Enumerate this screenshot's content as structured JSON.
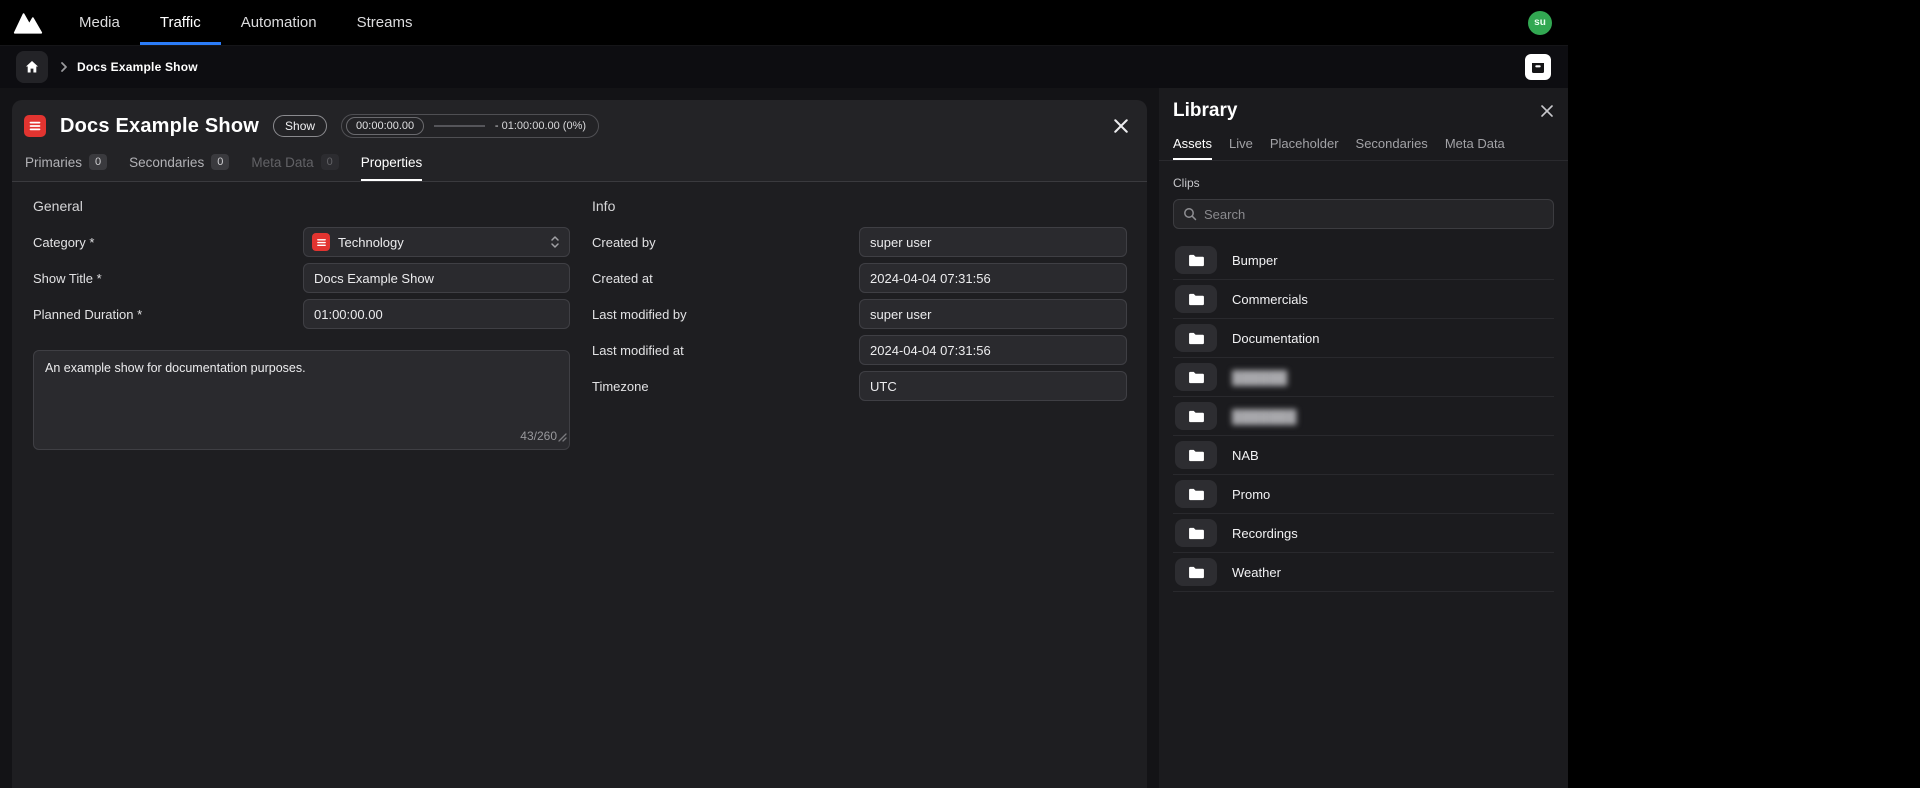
{
  "colors": {
    "accent_blue": "#2b7cf8",
    "category_red": "#e23430",
    "avatar_green": "#32a852"
  },
  "topnav": {
    "items": [
      {
        "label": "Media"
      },
      {
        "label": "Traffic",
        "active": true
      },
      {
        "label": "Automation"
      },
      {
        "label": "Streams"
      }
    ],
    "avatar_initials": "su"
  },
  "breadcrumb": {
    "current": "Docs Example Show"
  },
  "panel": {
    "title": "Docs Example Show",
    "type_badge": "Show",
    "progress": {
      "elapsed": "00:00:00.00",
      "remaining": "- 01:00:00.00 (0%)",
      "percent": 0
    },
    "tabs": [
      {
        "label": "Primaries",
        "count": "0"
      },
      {
        "label": "Secondaries",
        "count": "0"
      },
      {
        "label": "Meta Data",
        "count": "0",
        "disabled": true
      },
      {
        "label": "Properties",
        "active": true
      }
    ],
    "general": {
      "heading": "General",
      "fields": [
        {
          "label": "Category *",
          "value": "Technology",
          "type": "select"
        },
        {
          "label": "Show Title *",
          "value": "Docs Example Show",
          "type": "text"
        },
        {
          "label": "Planned Duration *",
          "value": "01:00:00.00",
          "type": "text"
        }
      ],
      "description": "An example show for documentation purposes.",
      "char_count": "43/260"
    },
    "info": {
      "heading": "Info",
      "fields": [
        {
          "label": "Created by",
          "value": "super user"
        },
        {
          "label": "Created at",
          "value": "2024-04-04 07:31:56"
        },
        {
          "label": "Last modified by",
          "value": "super user"
        },
        {
          "label": "Last modified at",
          "value": "2024-04-04 07:31:56"
        },
        {
          "label": "Timezone",
          "value": "UTC"
        }
      ]
    }
  },
  "library": {
    "title": "Library",
    "tabs": [
      {
        "label": "Assets",
        "active": true
      },
      {
        "label": "Live"
      },
      {
        "label": "Placeholder"
      },
      {
        "label": "Secondaries"
      },
      {
        "label": "Meta Data"
      }
    ],
    "section_label": "Clips",
    "search_placeholder": "Search",
    "folders": [
      {
        "label": "Bumper"
      },
      {
        "label": "Commercials"
      },
      {
        "label": "Documentation"
      },
      {
        "label": "██████",
        "blurred": true
      },
      {
        "label": "███████",
        "blurred": true
      },
      {
        "label": "NAB"
      },
      {
        "label": "Promo"
      },
      {
        "label": "Recordings"
      },
      {
        "label": "Weather"
      }
    ]
  }
}
